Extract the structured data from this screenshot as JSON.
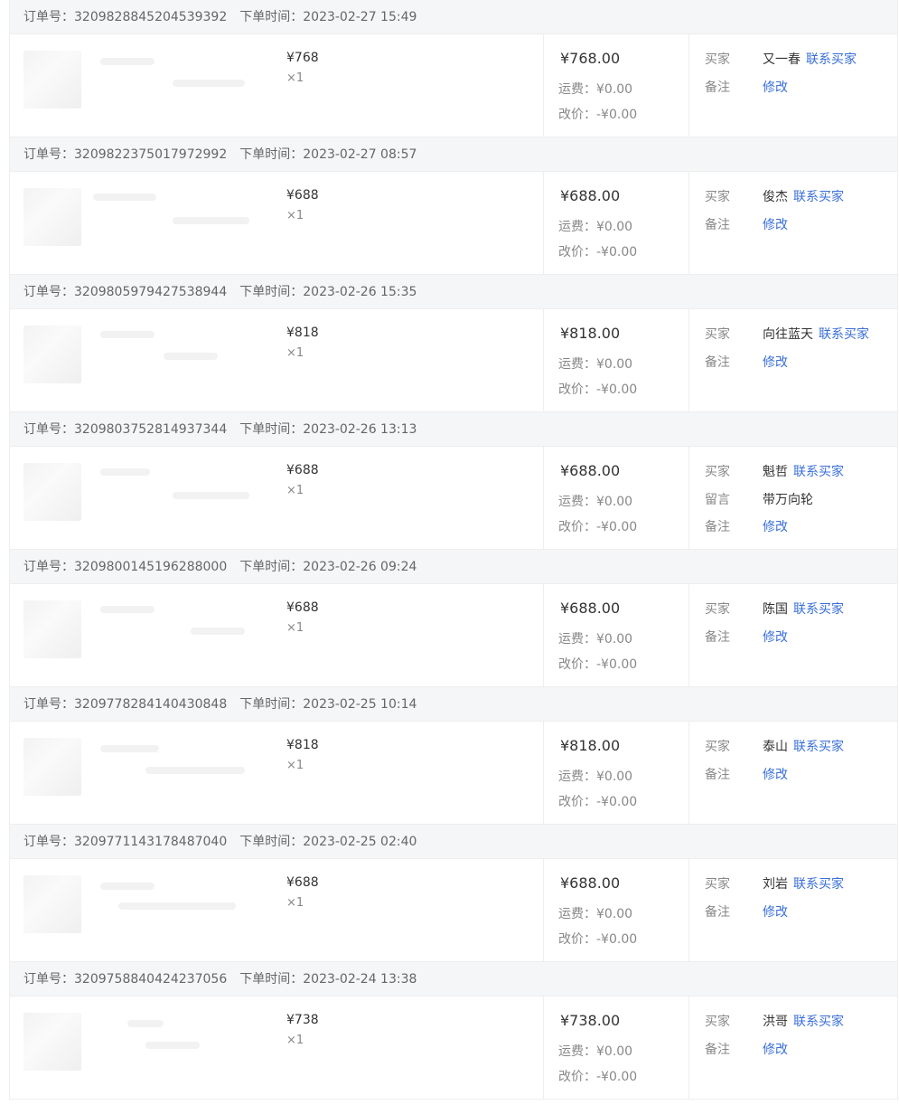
{
  "labels": {
    "order_no": "订单号：",
    "order_time": "下单时间：",
    "shipping": "运费：",
    "adjust": "改价：",
    "buyer": "买家",
    "contact": "联系买家",
    "remark": "备注",
    "modify": "修改",
    "message": "留言"
  },
  "orders": [
    {
      "order_no": "3209828845204539392",
      "time": "2023-02-27 15:49",
      "unit_price": "¥768",
      "qty": "×1",
      "total": "¥768.00",
      "shipping": "¥0.00",
      "adjust": "-¥0.00",
      "buyer": "又一春",
      "message": ""
    },
    {
      "order_no": "3209822375017972992",
      "time": "2023-02-27 08:57",
      "unit_price": "¥688",
      "qty": "×1",
      "total": "¥688.00",
      "shipping": "¥0.00",
      "adjust": "-¥0.00",
      "buyer": "俊杰",
      "message": ""
    },
    {
      "order_no": "3209805979427538944",
      "time": "2023-02-26 15:35",
      "unit_price": "¥818",
      "qty": "×1",
      "total": "¥818.00",
      "shipping": "¥0.00",
      "adjust": "-¥0.00",
      "buyer": "向往蓝天",
      "message": ""
    },
    {
      "order_no": "3209803752814937344",
      "time": "2023-02-26 13:13",
      "unit_price": "¥688",
      "qty": "×1",
      "total": "¥688.00",
      "shipping": "¥0.00",
      "adjust": "-¥0.00",
      "buyer": "魁哲",
      "message": "带万向轮"
    },
    {
      "order_no": "3209800145196288000",
      "time": "2023-02-26 09:24",
      "unit_price": "¥688",
      "qty": "×1",
      "total": "¥688.00",
      "shipping": "¥0.00",
      "adjust": "-¥0.00",
      "buyer": "陈国",
      "message": ""
    },
    {
      "order_no": "3209778284140430848",
      "time": "2023-02-25 10:14",
      "unit_price": "¥818",
      "qty": "×1",
      "total": "¥818.00",
      "shipping": "¥0.00",
      "adjust": "-¥0.00",
      "buyer": "泰山",
      "message": ""
    },
    {
      "order_no": "3209771143178487040",
      "time": "2023-02-25 02:40",
      "unit_price": "¥688",
      "qty": "×1",
      "total": "¥688.00",
      "shipping": "¥0.00",
      "adjust": "-¥0.00",
      "buyer": "刘岩",
      "message": ""
    },
    {
      "order_no": "3209758840424237056",
      "time": "2023-02-24 13:38",
      "unit_price": "¥738",
      "qty": "×1",
      "total": "¥738.00",
      "shipping": "¥0.00",
      "adjust": "-¥0.00",
      "buyer": "洪哥",
      "message": ""
    }
  ]
}
